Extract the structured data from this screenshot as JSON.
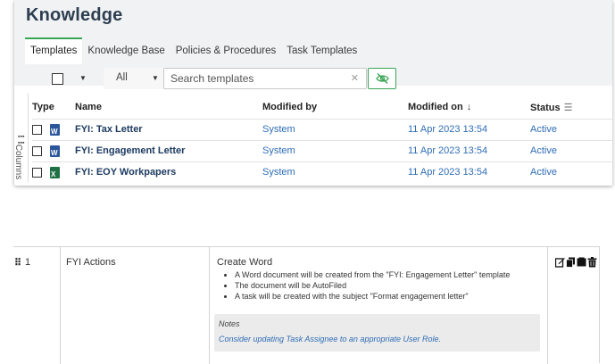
{
  "page": {
    "title": "Knowledge"
  },
  "tabs": [
    {
      "label": "Templates",
      "active": true
    },
    {
      "label": "Knowledge Base",
      "active": false
    },
    {
      "label": "Policies & Procedures",
      "active": false
    },
    {
      "label": "Task Templates",
      "active": false
    }
  ],
  "toolbar": {
    "filter_value": "All",
    "search_placeholder": "Search templates",
    "clear_icon": "close-icon",
    "visibility_icon": "eye-off-icon"
  },
  "columns_rail": {
    "label": "Columns"
  },
  "table": {
    "headers": {
      "type": "Type",
      "name": "Name",
      "modified_by": "Modified by",
      "modified_on": "Modified on",
      "status": "Status"
    },
    "rows": [
      {
        "file_type": "word",
        "badge": "W",
        "name": "FYI: Tax Letter",
        "modified_by": "System",
        "modified_on": "11 Apr 2023 13:54",
        "status": "Active"
      },
      {
        "file_type": "word",
        "badge": "W",
        "name": "FYI: Engagement Letter",
        "modified_by": "System",
        "modified_on": "11 Apr 2023 13:54",
        "status": "Active"
      },
      {
        "file_type": "excel",
        "badge": "X",
        "name": "FYI: EOY Workpapers",
        "modified_by": "System",
        "modified_on": "11 Apr 2023 13:54",
        "status": "Active"
      }
    ]
  },
  "action_row": {
    "sequence": "1",
    "action_type": "FYI Actions",
    "title": "Create Word",
    "bullets": [
      "A Word document will be created from the \"FYI: Engagement Letter\" template",
      "The document will be AutoFiled",
      "A task will be created with the subject \"Format engagement letter\""
    ],
    "notes_heading": "Notes",
    "notes_text": "Consider updating Task Assignee to an appropriate User Role.",
    "icons": [
      "edit-icon",
      "copy-icon",
      "duplicate-icon",
      "delete-icon"
    ]
  },
  "colors": {
    "accent_green": "#3aa655",
    "link_blue": "#2f6db5",
    "title_navy": "#2c3e50",
    "word_blue": "#2b579a",
    "excel_green": "#1e7145"
  }
}
